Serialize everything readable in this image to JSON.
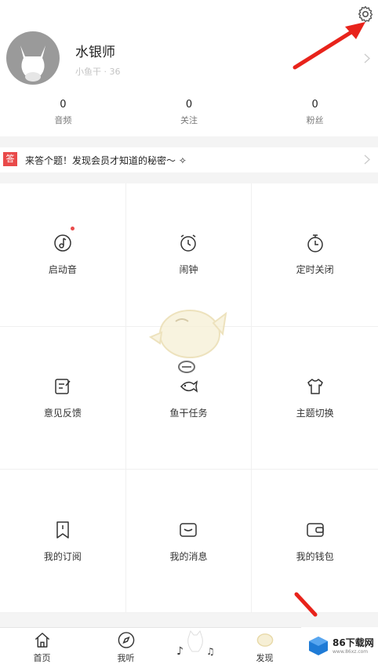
{
  "profile": {
    "name": "水银师",
    "subtitle": "小鱼干 · 36",
    "settings_icon": "gear-icon",
    "avatar_icon": "cat-avatar-icon"
  },
  "stats": [
    {
      "value": "0",
      "label": "音频"
    },
    {
      "value": "0",
      "label": "关注"
    },
    {
      "value": "0",
      "label": "粉丝"
    }
  ],
  "banner": {
    "badge": "答",
    "text": "来答个题！发现会员才知道的秘密～ ✧"
  },
  "grid": [
    {
      "label": "启动音",
      "icon": "music-note-icon",
      "has_dot": true
    },
    {
      "label": "闹钟",
      "icon": "alarm-clock-icon",
      "has_dot": false
    },
    {
      "label": "定时关闭",
      "icon": "stopwatch-icon",
      "has_dot": false
    },
    {
      "label": "意见反馈",
      "icon": "feedback-icon",
      "has_dot": false
    },
    {
      "label": "鱼干任务",
      "icon": "fish-task-icon",
      "has_dot": false
    },
    {
      "label": "主题切换",
      "icon": "tshirt-icon",
      "has_dot": false
    },
    {
      "label": "我的订阅",
      "icon": "bookmark-icon",
      "has_dot": false
    },
    {
      "label": "我的消息",
      "icon": "message-icon",
      "has_dot": false
    },
    {
      "label": "我的钱包",
      "icon": "wallet-icon",
      "has_dot": false
    }
  ],
  "tabbar": [
    {
      "label": "首页",
      "icon": "home-icon"
    },
    {
      "label": "我听",
      "icon": "compass-icon"
    },
    {
      "label": "",
      "icon": "cat-music-icon"
    },
    {
      "label": "发现",
      "icon": "discover-icon"
    }
  ],
  "watermark": {
    "text": "86下载网",
    "url_text": "www.86xz.com"
  },
  "colors": {
    "accent": "#e94a4a",
    "arrow": "#e8231b",
    "text": "#222222",
    "muted": "#777777"
  }
}
